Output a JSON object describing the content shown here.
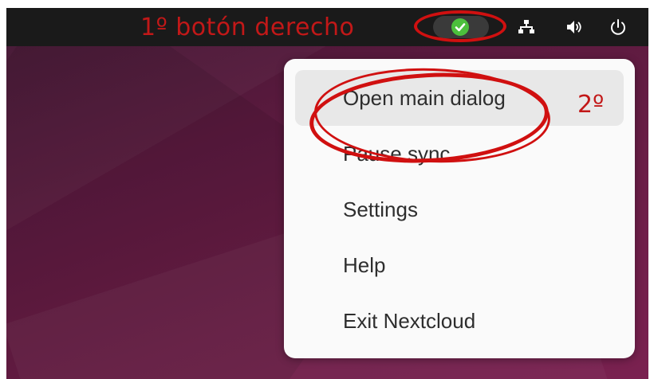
{
  "top_bar": {
    "annotation_1": "1º botón derecho",
    "tray_icon": "nextcloud-sync-ok-icon",
    "system_icons": [
      "network-wired-icon",
      "volume-icon",
      "power-icon"
    ]
  },
  "context_menu": {
    "items": [
      {
        "label": "Open main dialog",
        "hovered": true
      },
      {
        "label": "Pause sync"
      },
      {
        "label": "Settings"
      },
      {
        "label": "Help"
      },
      {
        "label": "Exit Nextcloud"
      }
    ],
    "annotation_2": "2º"
  },
  "colors": {
    "annotation": "#c21818",
    "topbar": "#1a1a1a",
    "sync_ok": "#4cbf3c",
    "menu_bg": "#fafafa",
    "menu_hover": "#e8e8e8"
  }
}
